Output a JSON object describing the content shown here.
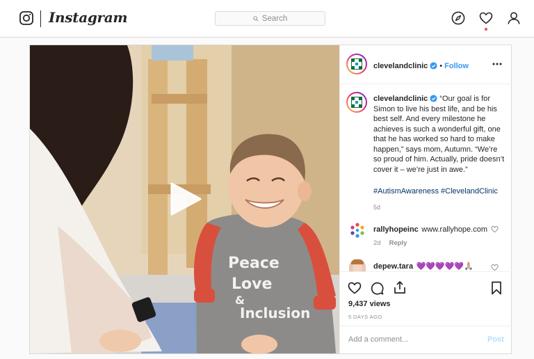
{
  "app": {
    "wordmark": "Instagram"
  },
  "search": {
    "placeholder": "Search"
  },
  "post": {
    "author": "clevelandclinic",
    "follow_label": "Follow",
    "separator": "•",
    "caption": "“Our goal is for Simon to live his best life, and be his best self. And every milestone he achieves is such a wonderful gift, one that he has worked so hard to make happen,” says mom, Autumn. “We’re so proud of him. Actually, pride doesn’t cover it – we’re just in awe.”",
    "hashtags": "#AutismAwareness #ClevelandClinic",
    "caption_age": "5d",
    "views": "9,437 views",
    "date": "5 DAYS AGO",
    "shirt_text": [
      "Peace",
      "Love",
      "&",
      "Inclusion"
    ]
  },
  "comments": [
    {
      "user": "rallyhopeinc",
      "text": "www.rallyhope.com",
      "age": "2d",
      "reply_label": "Reply"
    },
    {
      "user": "depew.tara",
      "text": "💜💜💜💜💜🙏🏼"
    }
  ],
  "add_comment": {
    "placeholder": "Add a comment...",
    "post_label": "Post"
  },
  "icons": [
    "instagram-glyph-icon",
    "search-icon",
    "explore-compass-icon",
    "activity-heart-icon",
    "profile-icon",
    "play-icon",
    "verified-badge-icon",
    "more-options-icon",
    "like-heart-icon",
    "comment-icon",
    "share-icon",
    "save-bookmark-icon"
  ],
  "colors": {
    "link": "#3897f0",
    "hashtag": "#003569",
    "muted": "#8e8e8e",
    "notification_dot": "#ed4956",
    "post_disabled": "#b2dffc",
    "shirt_sleeve": "#d94f3d"
  }
}
